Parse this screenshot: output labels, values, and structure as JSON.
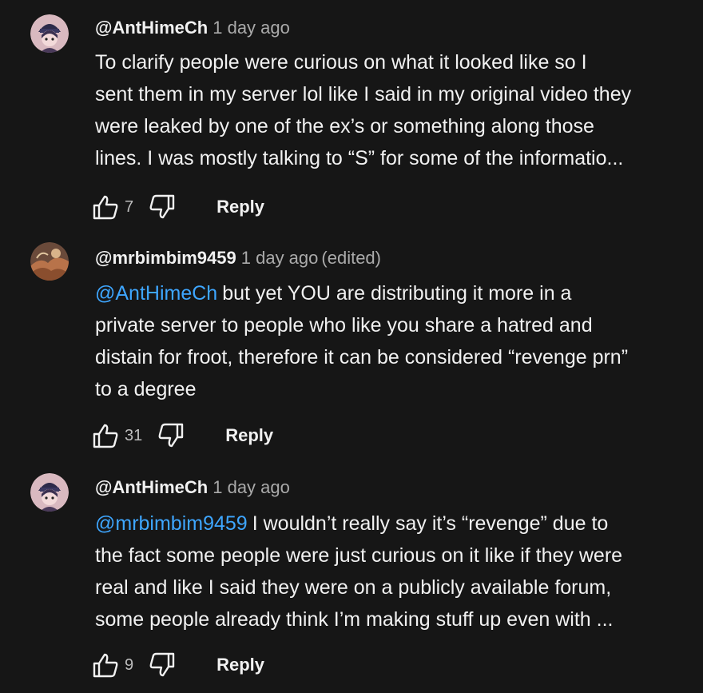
{
  "comments": [
    {
      "handle": "@AntHimeCh",
      "time": "1 day ago",
      "edited": "",
      "mention": "",
      "lines": [
        "To clarify people were curious on what it looked like so I",
        "sent them in my server lol like I said in my original video they",
        "were leaked by one of the ex’s or something along those",
        "lines. I was mostly talking to “S” for some of the informatio..."
      ],
      "likes": "7",
      "reply_label": "Reply"
    },
    {
      "handle": "@mrbimbim9459",
      "time": "1 day ago",
      "edited": "(edited)",
      "mention": "@AntHimeCh",
      "lines": [
        "but yet YOU are distributing it more in a",
        "private server to people who like you share a hatred and",
        "distain for froot, therefore it can be considered “revenge prn”",
        "to a degree"
      ],
      "likes": "31",
      "reply_label": "Reply"
    },
    {
      "handle": "@AntHimeCh",
      "time": "1 day ago",
      "edited": "",
      "mention": "@mrbimbim9459",
      "lines": [
        "I wouldn’t really say it’s “revenge” due to",
        "the fact some people were just curious on it like if they were",
        "real and like I said they were on a publicly available forum,",
        "some people already think I’m making stuff up even with ..."
      ],
      "likes": "9",
      "reply_label": "Reply"
    }
  ],
  "colors": {
    "background": "#161616",
    "mention": "#3ea6ff",
    "secondary_text": "#aaaaaa"
  }
}
